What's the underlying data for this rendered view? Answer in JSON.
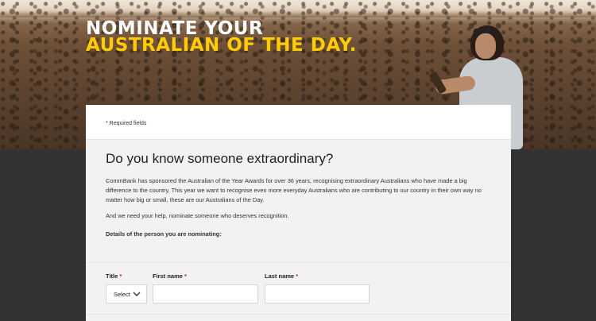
{
  "hero": {
    "headline_line1": "NOMINATE YOUR",
    "headline_line2": "AUSTRALIAN OF THE DAY."
  },
  "form": {
    "required_note": "* Required fields",
    "heading": "Do you know someone extraordinary?",
    "intro": "CommBank has sponsored the Australian of the Year Awards for over 36 years, recognising extraordinary Australians who have made a big difference to the country. This year we want to recognise even more everyday Australians who are contributing to our country in their own way no matter how big or small, these are our Australians of the Day.",
    "help_text": "And we need your help, nominate someone who deserves recognition.",
    "section_label": "Details of the person you are nominating:",
    "fields": {
      "title_label": "Title",
      "title_value": "Select",
      "first_name_label": "First name",
      "first_name_value": "",
      "last_name_label": "Last name",
      "last_name_value": "",
      "required_marker": "*"
    }
  },
  "colors": {
    "headline_accent": "#ffcc00",
    "required_star": "#cc1f1f",
    "page_background": "#333132"
  }
}
